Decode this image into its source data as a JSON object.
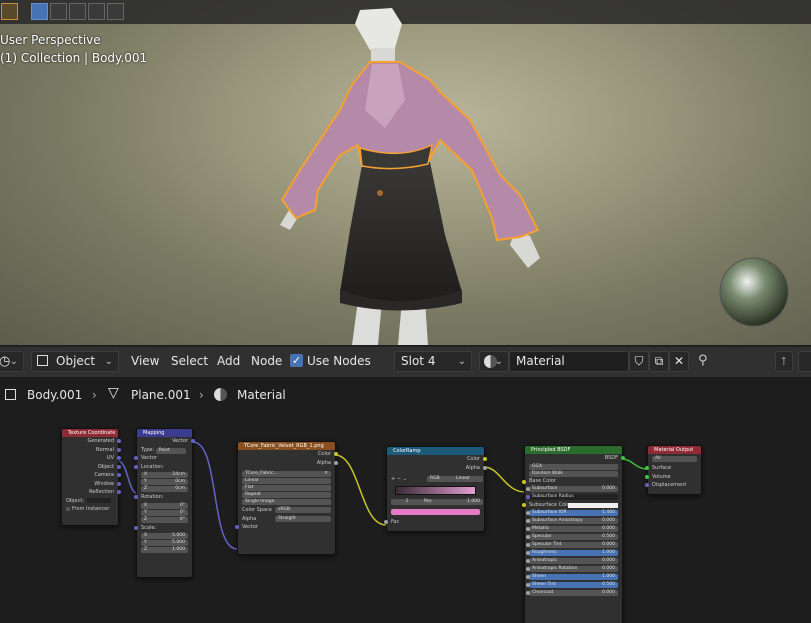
{
  "viewport": {
    "line1": "User Perspective",
    "line2": "(1) Collection | Body.001"
  },
  "header": {
    "editor_type_icon": "node-editor-icon",
    "object_dropdown": "Object",
    "menus": [
      "View",
      "Select",
      "Add",
      "Node"
    ],
    "use_nodes_label": "Use Nodes",
    "use_nodes_checked": true,
    "slot_dropdown": "Slot 4",
    "material_name": "Material"
  },
  "breadcrumb": {
    "item1": "Body.001",
    "item2": "Plane.001",
    "item3": "Material"
  },
  "nodes": {
    "texcoord": {
      "title": "Texture Coordinate",
      "outputs": [
        "Generated",
        "Normal",
        "UV",
        "Object",
        "Camera",
        "Window",
        "Reflection"
      ],
      "object_label": "Object:",
      "from_instancer": "From Instancer"
    },
    "mapping": {
      "title": "Mapping",
      "output": "Vector",
      "type_label": "Type:",
      "type_value": "Point",
      "vector_label": "Vector",
      "location_label": "Location:",
      "rotation_label": "Rotation:",
      "scale_label": "Scale:",
      "loc": [
        "X",
        "24cm",
        "Y",
        "0cm",
        "Z",
        "0cm"
      ],
      "rot": [
        "X",
        "0°",
        "Y",
        "0°",
        "Z",
        "0°"
      ],
      "scale": [
        "X",
        "5.000",
        "Y",
        "5.000",
        "Z",
        "1.000"
      ]
    },
    "image": {
      "title": "TCore_Fabric_Velvet_RGB_1.png",
      "out_color": "Color",
      "out_alpha": "Alpha",
      "image_name": "TCore_Fabric...",
      "interp": "Linear",
      "proj": "Flat",
      "ext": "Repeat",
      "source": "Single Image",
      "colorspace_label": "Color Space",
      "colorspace_value": "sRGB",
      "alpha_label": "Alpha",
      "alpha_value": "Straight",
      "vector": "Vector"
    },
    "ramp": {
      "title": "ColorRamp",
      "out_color": "Color",
      "out_alpha": "Alpha",
      "mode": "RGB",
      "interp": "Linear",
      "index": "1",
      "pos_label": "Pos",
      "pos_value": "1.000",
      "fac": "Fac"
    },
    "bsdf": {
      "title": "Principled BSDF",
      "output": "BSDF",
      "dist": "GGX",
      "sss": "Random Walk",
      "rows": [
        {
          "label": "Base Color",
          "value": "",
          "style": "plain"
        },
        {
          "label": "Subsurface",
          "value": "0.000",
          "style": "field"
        },
        {
          "label": "Subsurface Radius",
          "value": "",
          "style": "dark"
        },
        {
          "label": "Subsurface Color",
          "value": "",
          "style": "swatch"
        },
        {
          "label": "Subsurface IOR",
          "value": "1.400",
          "style": "blue"
        },
        {
          "label": "Subsurface Anisotropy",
          "value": "0.000",
          "style": "field"
        },
        {
          "label": "Metallic",
          "value": "0.000",
          "style": "field"
        },
        {
          "label": "Specular",
          "value": "0.500",
          "style": "field"
        },
        {
          "label": "Specular Tint",
          "value": "0.000",
          "style": "field"
        },
        {
          "label": "Roughness",
          "value": "1.000",
          "style": "blue"
        },
        {
          "label": "Anisotropic",
          "value": "0.000",
          "style": "field"
        },
        {
          "label": "Anisotropic Rotation",
          "value": "0.000",
          "style": "field"
        },
        {
          "label": "Sheen",
          "value": "1.000",
          "style": "blue"
        },
        {
          "label": "Sheen Tint",
          "value": "0.500",
          "style": "blue"
        },
        {
          "label": "Clearcoat",
          "value": "0.000",
          "style": "field"
        }
      ]
    },
    "output": {
      "title": "Material Output",
      "target": "All",
      "inputs": [
        "Surface",
        "Volume",
        "Displacement"
      ]
    }
  },
  "colors": {
    "accent": "#4772b3",
    "selection": "#f5a030",
    "shader_header": "#2b6b2b",
    "texture_header": "#8a4f1e",
    "converter_header": "#1d5a7a",
    "vector_header": "#3b3b8f",
    "input_header": "#8f2b35",
    "output_header": "#8f2b35"
  }
}
